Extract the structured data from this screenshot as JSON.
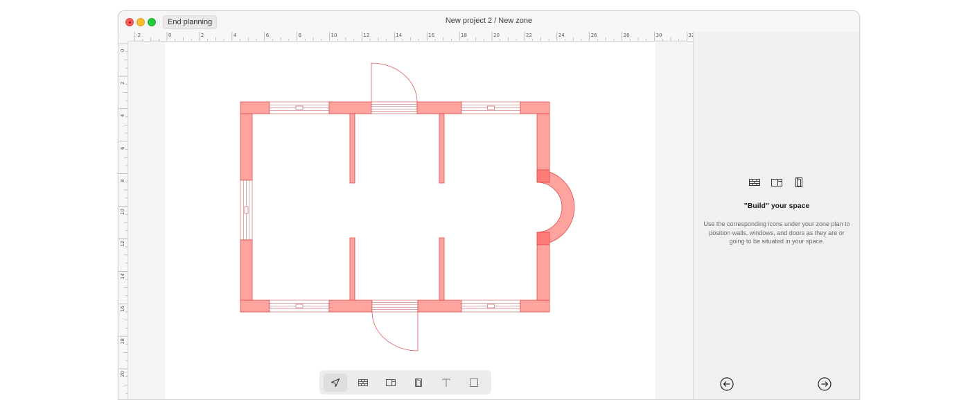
{
  "window": {
    "title": "New project 2 / New zone",
    "end_planning_label": "End planning"
  },
  "ruler": {
    "top_labels": [
      "-2",
      "0",
      "2",
      "4",
      "6",
      "8",
      "10",
      "12",
      "14",
      "16",
      "18",
      "20",
      "22",
      "24",
      "26",
      "28",
      "30",
      "32"
    ],
    "left_labels": [
      "0",
      "2",
      "4",
      "6",
      "8",
      "10",
      "12",
      "14",
      "16",
      "18",
      "20"
    ]
  },
  "panel": {
    "icons": [
      "wall-icon",
      "window-icon",
      "door-icon"
    ],
    "title": "\"Build\" your space",
    "description": "Use the corresponding icons under your zone plan to position walls, windows, and doors as they are or going to be situated in your space.",
    "nav": [
      "back-arrow-icon",
      "forward-arrow-icon"
    ]
  },
  "toolbar": {
    "tools": [
      "select-arrow-icon",
      "wall-icon",
      "window-icon",
      "door-icon",
      "text-icon",
      "rectangle-icon"
    ],
    "active": "select-arrow-icon"
  },
  "colors": {
    "wall_fill": "#ffa39e",
    "wall_stroke": "#e24a4a",
    "door_stroke": "#e05a5a"
  }
}
